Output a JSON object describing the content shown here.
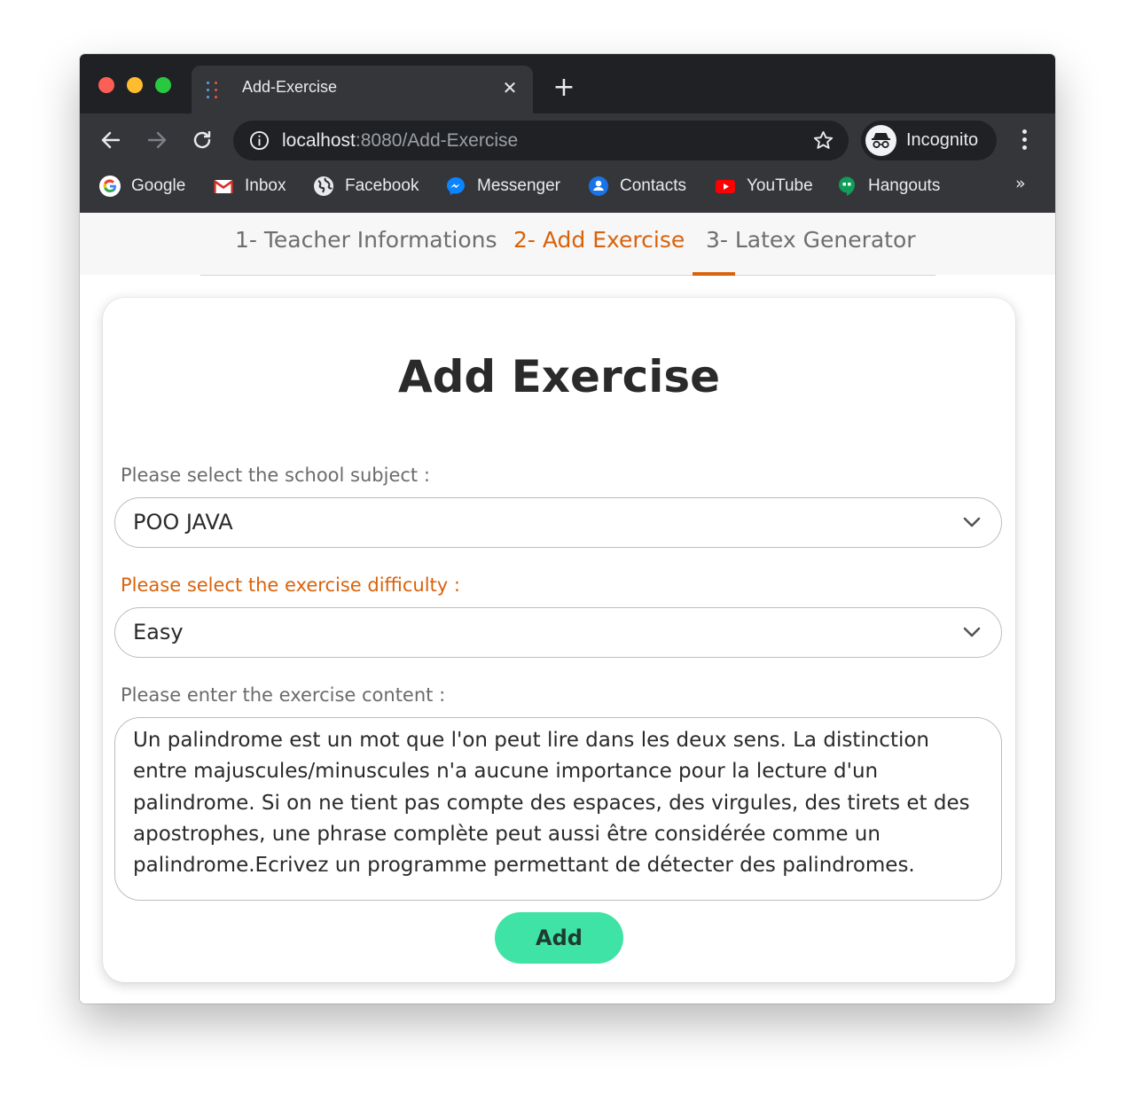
{
  "browser": {
    "tab_title": "Add-Exercise",
    "url_host": "localhost",
    "url_rest": ":8080/Add-Exercise",
    "profile_label": "Incognito",
    "bookmarks": [
      {
        "label": "Google",
        "icon": "google-icon"
      },
      {
        "label": "Inbox",
        "icon": "gmail-icon"
      },
      {
        "label": "Facebook",
        "icon": "globe-icon"
      },
      {
        "label": "Messenger",
        "icon": "messenger-icon"
      },
      {
        "label": "Contacts",
        "icon": "contacts-icon"
      },
      {
        "label": "YouTube",
        "icon": "youtube-icon"
      },
      {
        "label": "Hangouts",
        "icon": "hangouts-icon"
      }
    ],
    "more_bookmarks": "»"
  },
  "steps": [
    {
      "label": "1- Teacher Informations",
      "active": false
    },
    {
      "label": "2- Add Exercise",
      "active": true
    },
    {
      "label": "3- Latex Generator",
      "active": false
    }
  ],
  "form": {
    "title": "Add Exercise",
    "subject_label": "Please select the school subject :",
    "subject_value": "POO JAVA",
    "difficulty_label": "Please select the exercise difficulty :",
    "difficulty_value": "Easy",
    "content_label": "Please enter the exercise content :",
    "content_value": "Un palindrome est un mot que l'on peut lire dans les deux sens. La distinction\nentre majuscules/minuscules n'a aucune importance pour la lecture d'un\npalindrome. Si on ne tient pas compte des espaces, des virgules, des tirets et des\napostrophes, une phrase complète peut aussi être considérée comme un\npalindrome.Ecrivez un programme permettant de détecter des palindromes.",
    "submit_label": "Add"
  },
  "colors": {
    "accent": "#d9620b",
    "button": "#3fe3a6",
    "chrome_dark": "#35363a"
  }
}
